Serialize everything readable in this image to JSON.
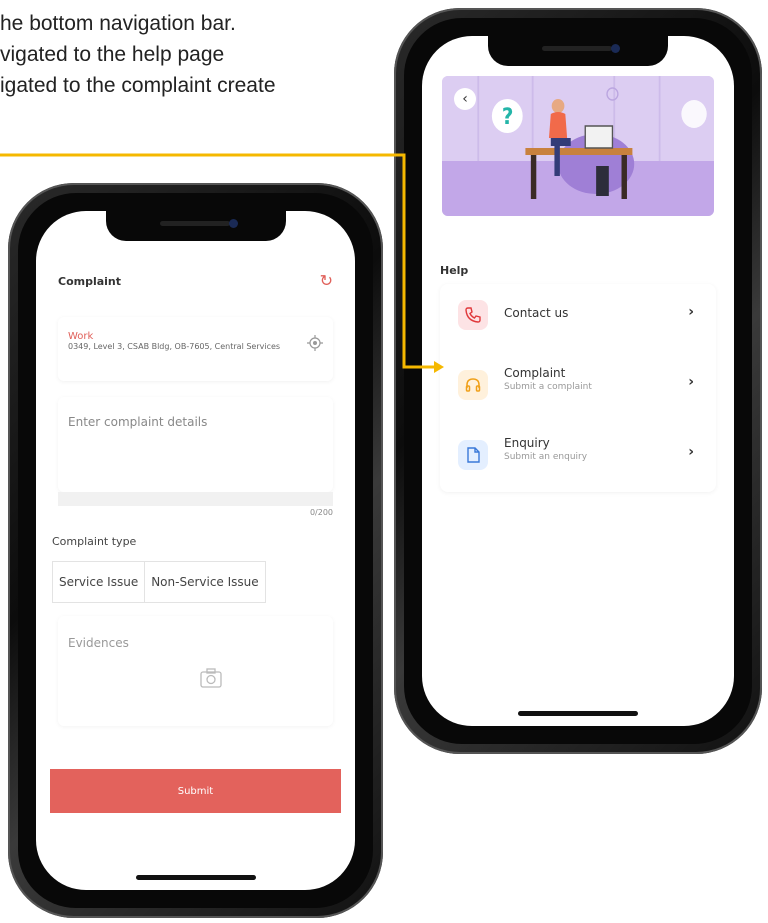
{
  "caption": {
    "line1": "he bottom navigation bar.",
    "line2": "vigated to the help page",
    "line3": "igated to the complaint create"
  },
  "colors": {
    "accent": "#e3625c",
    "connector": "#f5b800",
    "banner": "#d7c8ef"
  },
  "complaint_screen": {
    "title": "Complaint",
    "refresh_icon": "refresh-icon",
    "address": {
      "label": "Work",
      "text": "0349, Level 3, CSAB Bldg, OB-7605, Central Services"
    },
    "details_placeholder": "Enter complaint details",
    "char_count": "0/200",
    "complaint_type_label": "Complaint type",
    "complaint_types": [
      "Service Issue",
      "Non-Service Issue"
    ],
    "evidences_label": "Evidences",
    "submit_label": "Submit"
  },
  "help_screen": {
    "title": "Help",
    "items": [
      {
        "title": "Contact us",
        "subtitle": "",
        "icon": "phone-icon",
        "color": "#fde3e5"
      },
      {
        "title": "Complaint",
        "subtitle": "Submit a complaint",
        "icon": "headphones-icon",
        "color": "#fff1dc"
      },
      {
        "title": "Enquiry",
        "subtitle": "Submit an enquiry",
        "icon": "document-icon",
        "color": "#e4efff"
      }
    ]
  }
}
